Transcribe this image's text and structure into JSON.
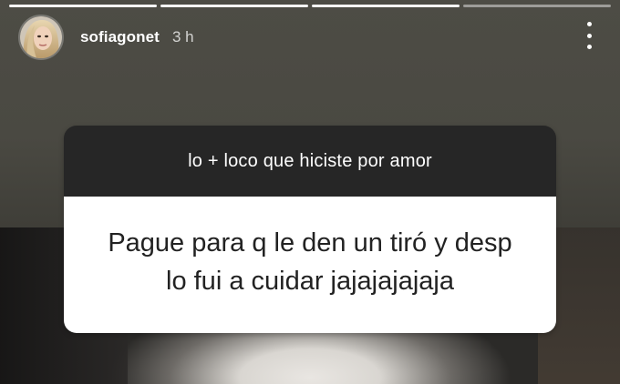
{
  "story": {
    "progress_segments": [
      {
        "filled": true
      },
      {
        "filled": true
      },
      {
        "filled": true
      },
      {
        "filled": false
      }
    ],
    "username": "sofiagonet",
    "time_ago": "3 h",
    "more_icon": "more-vertical-icon"
  },
  "question_card": {
    "question": "lo + loco que hiciste por amor",
    "answer_lines": [
      "Pague para q le den un tiró y desp",
      "lo fui a cuidar jajajajajaja"
    ]
  },
  "colors": {
    "question_background": "#262626",
    "answer_background": "#ffffff",
    "story_background": "#4a4942"
  }
}
